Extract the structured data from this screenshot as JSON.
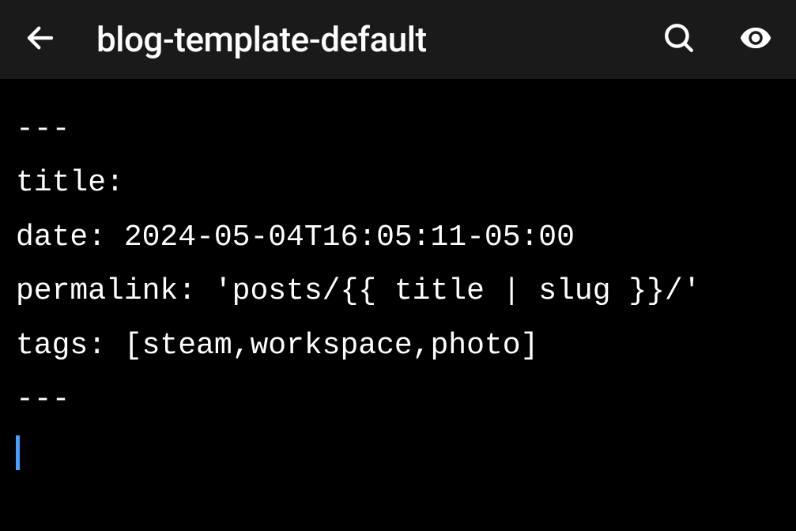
{
  "header": {
    "title": "blog-template-default"
  },
  "editor": {
    "lines": [
      "---",
      "title:",
      "date: 2024-05-04T16:05:11-05:00",
      "permalink: 'posts/{{ title | slug }}/'",
      "tags: [steam,workspace,photo]",
      "---"
    ]
  }
}
